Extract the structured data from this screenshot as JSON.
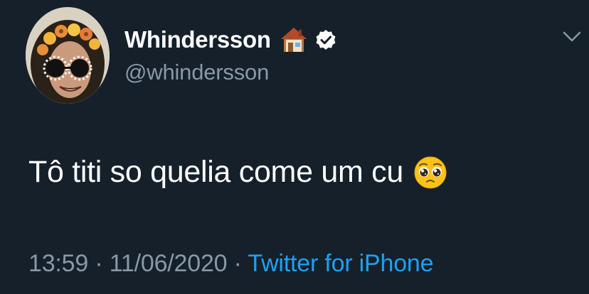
{
  "author": {
    "display_name": "Whindersson",
    "handle": "@whindersson",
    "name_emoji_icon": "house-icon",
    "verified_icon": "verified-badge-icon",
    "avatar": "profile-photo"
  },
  "tweet": {
    "text": "Tô titi so quelia come um cu",
    "trailing_emoji_icon": "pleading-face-icon"
  },
  "meta": {
    "time": "13:59",
    "separator": " · ",
    "date": "11/06/2020",
    "source": "Twitter for iPhone"
  },
  "menu": {
    "icon": "chevron-down-icon"
  },
  "colors": {
    "background": "#15202b",
    "text": "#ffffff",
    "secondary": "#8899a6",
    "link": "#1da1f2"
  }
}
